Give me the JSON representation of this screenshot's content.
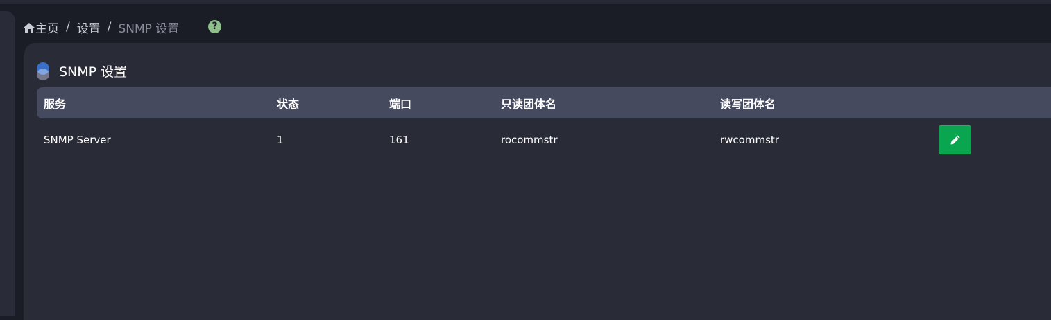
{
  "breadcrumb": {
    "home": "主页",
    "separator": "/",
    "settings": "设置",
    "current": "SNMP 设置"
  },
  "help_icon": "question-circle-icon",
  "card": {
    "title": "SNMP 设置"
  },
  "table": {
    "headers": [
      "服务",
      "状态",
      "端口",
      "只读团体名",
      "读写团体名",
      ""
    ],
    "rows": [
      {
        "service": "SNMP Server",
        "status": "1",
        "port": "161",
        "ro_community": "rocommstr",
        "rw_community": "rwcommstr",
        "action_icon": "pencil-icon"
      }
    ]
  },
  "colors": {
    "background": "#1b1d26",
    "card": "#292b37",
    "table_header": "#464a5e",
    "edit_button": "#0aa64f",
    "help_icon": "#8fc08c",
    "title_dot": "#3a6fc7"
  }
}
